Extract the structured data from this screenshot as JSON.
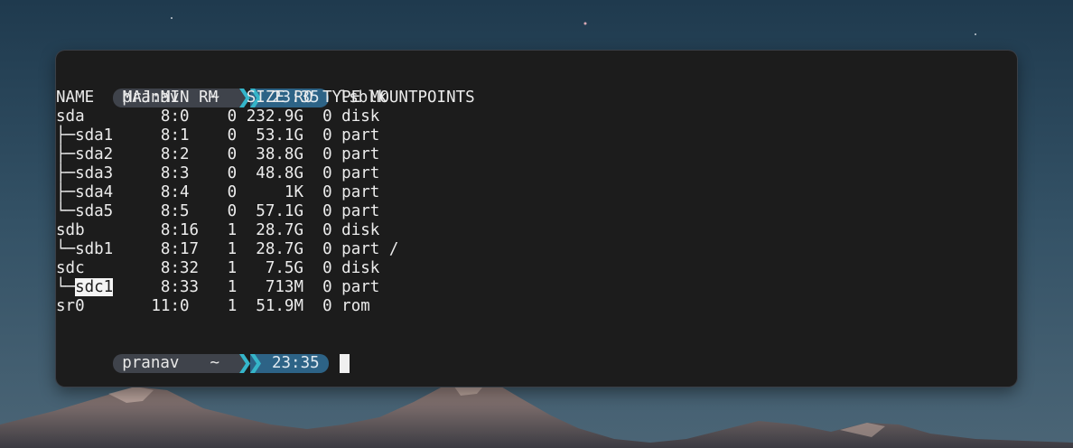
{
  "prompt1": {
    "user": "pranav",
    "dir": "~",
    "time": "23:35"
  },
  "command": "lsblk",
  "header": {
    "name": "NAME",
    "majmin": "MAJ:MIN",
    "rm": "RM",
    "size": "SIZE",
    "ro": "RO",
    "type": "TYPE",
    "mountpoints": "MOUNTPOINTS"
  },
  "rows": [
    {
      "name": "sda",
      "majmin": "8:0",
      "rm": "0",
      "size": "232.9G",
      "ro": "0",
      "type": "disk",
      "mount": ""
    },
    {
      "name": "├─sda1",
      "majmin": "8:1",
      "rm": "0",
      "size": "53.1G",
      "ro": "0",
      "type": "part",
      "mount": ""
    },
    {
      "name": "├─sda2",
      "majmin": "8:2",
      "rm": "0",
      "size": "38.8G",
      "ro": "0",
      "type": "part",
      "mount": ""
    },
    {
      "name": "├─sda3",
      "majmin": "8:3",
      "rm": "0",
      "size": "48.8G",
      "ro": "0",
      "type": "part",
      "mount": ""
    },
    {
      "name": "├─sda4",
      "majmin": "8:4",
      "rm": "0",
      "size": "1K",
      "ro": "0",
      "type": "part",
      "mount": ""
    },
    {
      "name": "└─sda5",
      "majmin": "8:5",
      "rm": "0",
      "size": "57.1G",
      "ro": "0",
      "type": "part",
      "mount": ""
    },
    {
      "name": "sdb",
      "majmin": "8:16",
      "rm": "1",
      "size": "28.7G",
      "ro": "0",
      "type": "disk",
      "mount": ""
    },
    {
      "name": "└─sdb1",
      "majmin": "8:17",
      "rm": "1",
      "size": "28.7G",
      "ro": "0",
      "type": "part",
      "mount": "/"
    },
    {
      "name": "sdc",
      "majmin": "8:32",
      "rm": "1",
      "size": "7.5G",
      "ro": "0",
      "type": "disk",
      "mount": ""
    },
    {
      "name": "└─sdc1",
      "name_tree": "└─",
      "name_sel": "sdc1",
      "majmin": "8:33",
      "rm": "1",
      "size": "713M",
      "ro": "0",
      "type": "part",
      "mount": ""
    },
    {
      "name": "sr0",
      "majmin": "11:0",
      "rm": "1",
      "size": "51.9M",
      "ro": "0",
      "type": "rom",
      "mount": ""
    }
  ],
  "prompt2": {
    "user": "pranav",
    "dir": "~",
    "time": "23:35"
  },
  "colors": {
    "terminal_bg": "#1c1c1c",
    "prompt_segment": "#3f434b",
    "time_segment": "#2d6386",
    "chevron_accent": "#35b5c9",
    "text": "#ececec"
  }
}
